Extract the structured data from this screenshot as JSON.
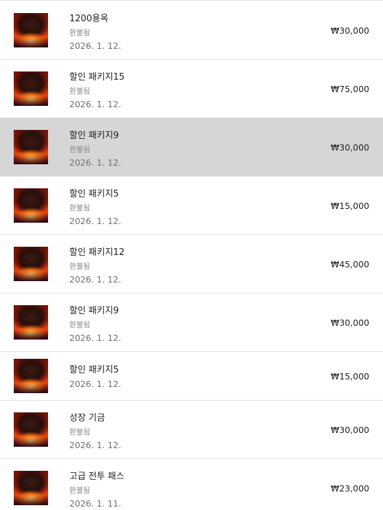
{
  "purchases": [
    {
      "name": "1200용옥",
      "status": "환불됨",
      "date": "2026. 1. 12.",
      "price": "₩30,000"
    },
    {
      "name": "할인 패키지15",
      "status": "환불됨",
      "date": "2026. 1. 12.",
      "price": "₩75,000"
    },
    {
      "name": "할인 패키지9",
      "status": "환불됨",
      "date": "2026. 1. 12.",
      "price": "₩30,000"
    },
    {
      "name": "할인 패키지5",
      "status": "환불됨",
      "date": "2026. 1. 12.",
      "price": "₩15,000"
    },
    {
      "name": "할인 패키지12",
      "status": "환불됨",
      "date": "2026. 1. 12.",
      "price": "₩45,000"
    },
    {
      "name": "할인 패키지9",
      "status": "환불됨",
      "date": "2026. 1. 12.",
      "price": "₩30,000"
    },
    {
      "name": "할인 패키지5",
      "status": "",
      "date": "2026. 1. 12.",
      "price": "₩15,000"
    },
    {
      "name": "성장 기금",
      "status": "환불됨",
      "date": "2026. 1. 12.",
      "price": "₩30,000"
    },
    {
      "name": "고급 전투 패스",
      "status": "환불됨",
      "date": "2026. 1. 11.",
      "price": "₩23,000"
    }
  ]
}
